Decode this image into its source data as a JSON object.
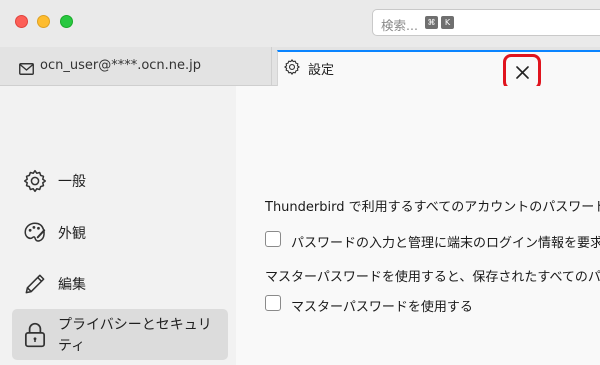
{
  "search": {
    "placeholder": "検索...",
    "key1": "⌘",
    "key2": "K"
  },
  "tabs": {
    "mail_label": "ocn_user@****.ocn.ne.jp",
    "settings_label": "設定"
  },
  "sidebar": {
    "items": [
      {
        "label": "一般",
        "icon": "gear-icon"
      },
      {
        "label": "外観",
        "icon": "palette-icon"
      },
      {
        "label": "編集",
        "icon": "pencil-icon"
      },
      {
        "label": "プライバシーとセキュリティ",
        "icon": "lock-icon",
        "active": true
      }
    ]
  },
  "content": {
    "intro_text": "Thunderbird で利用するすべてのアカウントのパスワード",
    "os_auth_checkbox_label": "パスワードの入力と管理に端末のログイン情報を要求す",
    "os_auth_checked": false,
    "master_desc": "マスターパスワードを使用すると、保存されたすべてのパ",
    "master_checkbox_label": "マスターパスワードを使用する",
    "master_checked": false
  },
  "colors": {
    "accent": "#0a84ff",
    "highlight": "#e0141e"
  }
}
